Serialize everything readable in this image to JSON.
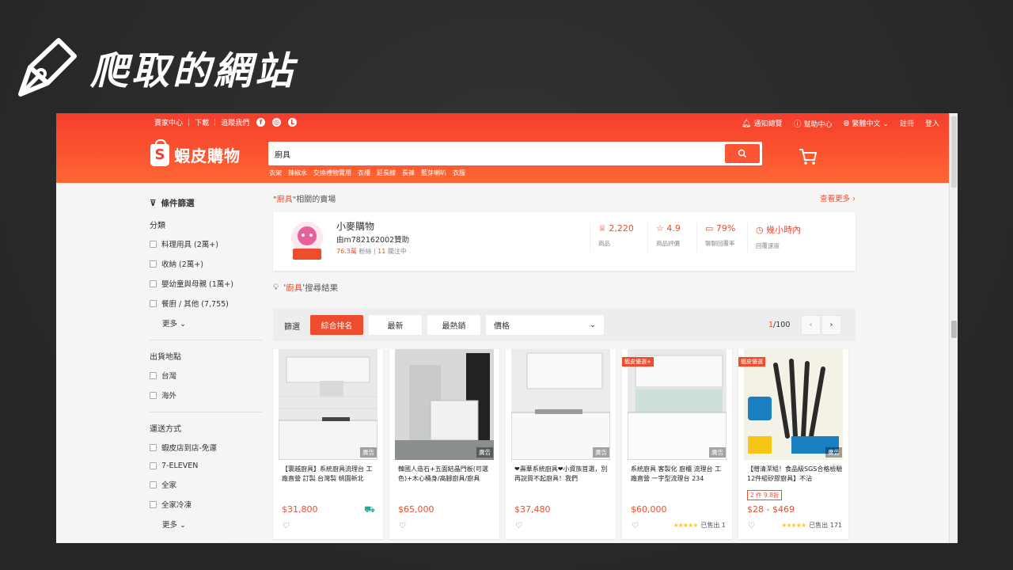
{
  "slide": {
    "title": "爬取的網站"
  },
  "topbar": {
    "left": [
      "賣家中心",
      "下載",
      "追蹤我們"
    ],
    "notify": "通知總覽",
    "help": "幫助中心",
    "lang": "繁體中文",
    "register": "註冊",
    "login": "登入"
  },
  "logo": {
    "name": "蝦皮購物"
  },
  "search": {
    "value": "廚具",
    "hints": [
      "衣架",
      "辣椒水",
      "交換禮物實用",
      "衣櫃",
      "延長線",
      "長褲",
      "藍芽喇叭",
      "衣服"
    ]
  },
  "sidebar": {
    "filter_title": "條件篩選",
    "category_title": "分類",
    "categories": [
      "料理用具 (2萬+)",
      "收納 (2萬+)",
      "嬰幼童與母親 (1萬+)",
      "餐廚 / 其他 (7,755)"
    ],
    "more": "更多",
    "location_title": "出貨地點",
    "locations": [
      "台灣",
      "海外"
    ],
    "shipping_title": "運送方式",
    "shipping": [
      "蝦皮店到店-免運",
      "7-ELEVEN",
      "全家",
      "全家冷凍"
    ]
  },
  "related": {
    "prefix": "\"",
    "keyword": "廚具",
    "suffix": "\"相關的賣場",
    "see_more": "查看更多"
  },
  "shop": {
    "name": "小麥購物",
    "id": "由m782162002贊助",
    "fans": "76.3萬",
    "fans_label": "粉絲",
    "following": "11",
    "following_label": "關注中",
    "stats": [
      {
        "value": "2,220",
        "label": "商品"
      },
      {
        "value": "4.9",
        "label": "商品評價"
      },
      {
        "value": "79%",
        "label": "聊聊回覆率"
      },
      {
        "value": "幾小時內",
        "label": "回覆速度"
      }
    ]
  },
  "result": {
    "prefix": "'",
    "keyword": "廚具",
    "suffix": "'搜尋結果"
  },
  "sort": {
    "label": "篩選",
    "buttons": [
      "綜合排名",
      "最新",
      "最熱銷"
    ],
    "price": "價格",
    "page_current": "1",
    "page_total": "/100"
  },
  "products": [
    {
      "title": "【寰越廚具】系統廚具流理台 工廠直營 訂製 台灣製 桃園新北",
      "price": "$31,800",
      "ad": "廣告"
    },
    {
      "title": "韓國人造石+五面結晶門板(可選色)+木心桶身/高腳廚具/廚具",
      "price": "$65,000",
      "ad": "廣告"
    },
    {
      "title": "❤壽華系統廚具❤小資族首選，別再說買不起廚具！我們",
      "price": "$37,480",
      "ad": "廣告"
    },
    {
      "title": "系統廚具 客製化 廚櫃 流理台 工廠直營 一字型流理台 234",
      "price": "$60,000",
      "ad": "廣告",
      "sold": "已售出 1",
      "badge": "蝦皮優選+"
    },
    {
      "title": "【贈清潔組！食品級SGS合格檢驗 12件組矽膠廚具】不沾",
      "price": "$28 - $469",
      "ad": "廣告",
      "sold": "已售出 171",
      "promo": "2 件 9.8折",
      "badge": "蝦皮優選"
    }
  ]
}
